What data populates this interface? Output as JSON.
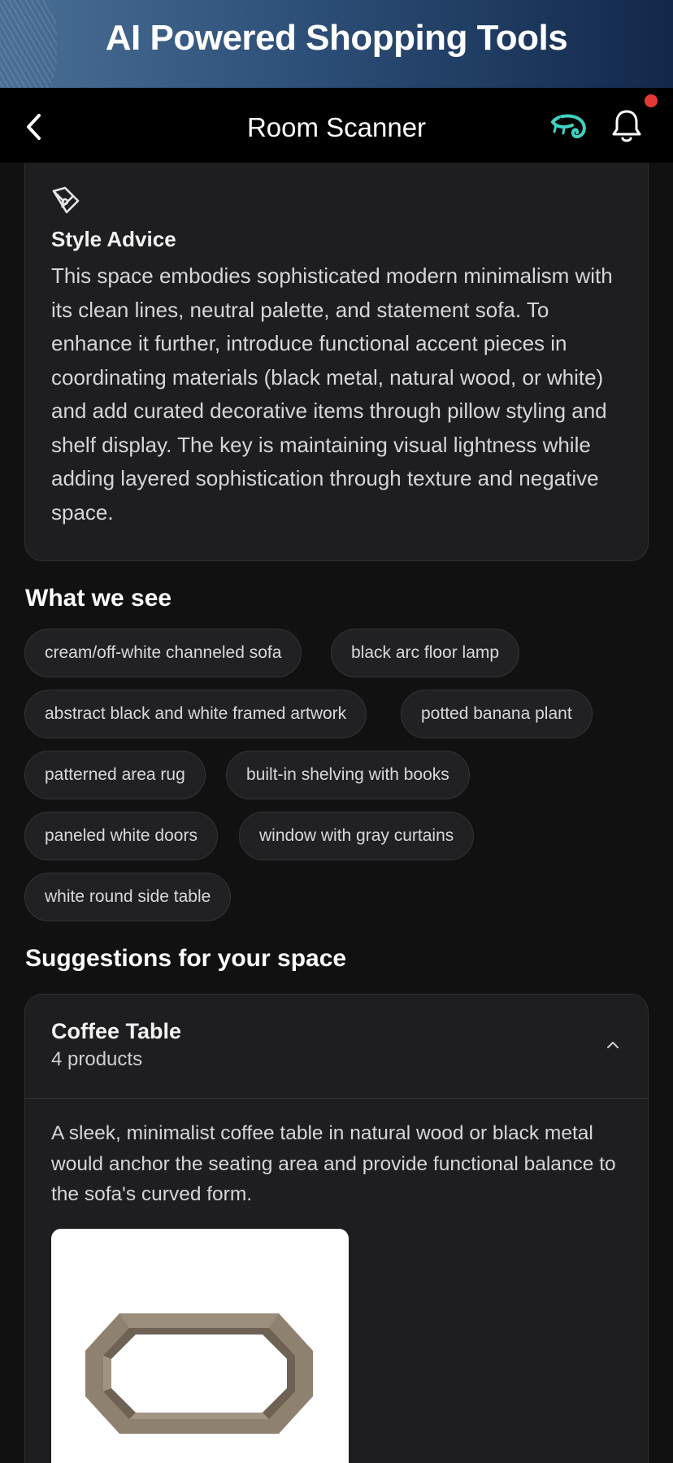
{
  "banner": {
    "title": "AI Powered Shopping Tools"
  },
  "nav": {
    "title": "Room Scanner",
    "has_notification": true
  },
  "style_advice": {
    "title": "Style Advice",
    "body": "This space embodies sophisticated modern minimalism with its clean lines, neutral palette, and statement sofa. To enhance it further, introduce functional accent pieces in coordinating materials (black metal, natural wood, or white) and add curated decorative items through pillow styling and shelf display. The key is maintaining visual lightness while adding layered sophistication through texture and negative space."
  },
  "what_we_see": {
    "title": "What we see",
    "tags": [
      "cream/off-white channeled sofa",
      "black arc floor lamp",
      "abstract black and white framed artwork",
      "potted banana plant",
      "patterned area rug",
      "built-in shelving with books",
      "paneled white doors",
      "window with gray curtains",
      "white round side table"
    ]
  },
  "suggestions": {
    "title": "Suggestions for your space",
    "items": [
      {
        "title": "Coffee Table",
        "count": "4 products",
        "description": "A sleek, minimalist coffee table in natural wood or black metal would anchor the seating area and provide functional balance to the sofa's curved form.",
        "expanded": true
      }
    ]
  },
  "colors": {
    "background": "#111112",
    "card": "#1e1e20",
    "accent_logo": "#3fd1c1",
    "notification_dot": "#e53935"
  },
  "icons": {
    "back": "chevron-left-icon",
    "logo": "chameleon-logo",
    "notifications": "bell-icon",
    "style_advice": "pen-nib-icon",
    "collapse": "chevron-up-icon"
  }
}
